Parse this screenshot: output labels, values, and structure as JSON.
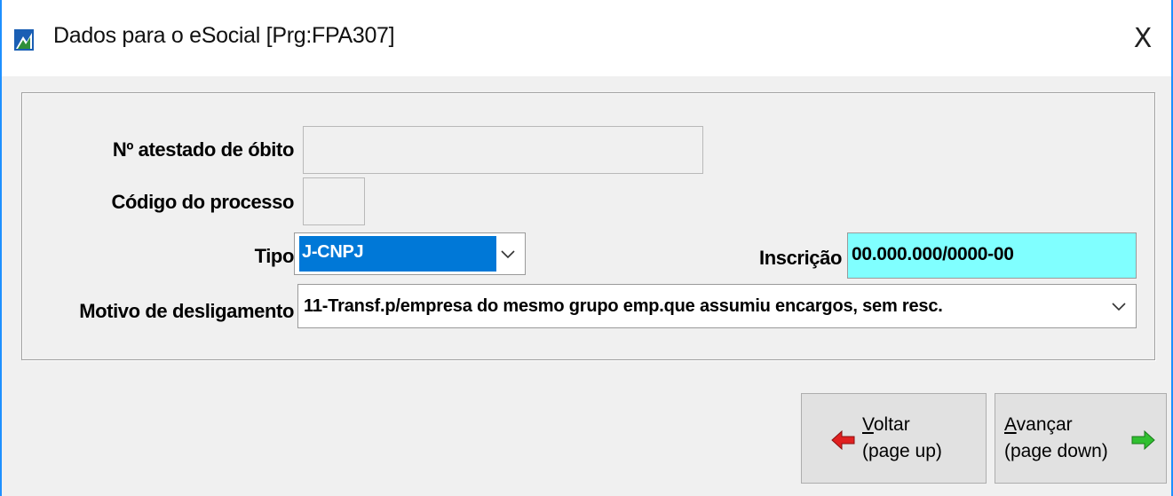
{
  "window": {
    "title": "Dados para o eSocial [Prg:FPA307]",
    "close_glyph": "X",
    "icon": "app-logo-icon"
  },
  "form": {
    "atestado_label": "Nº atestado de óbito",
    "atestado_value": "",
    "codigo_label": "Código do processo",
    "codigo_value": "",
    "tipo_label": "Tipo",
    "tipo_value": "J-CNPJ",
    "inscricao_label": "Inscrição",
    "inscricao_value": "00.000.000/0000-00",
    "motivo_label": "Motivo de desligamento",
    "motivo_value": "11-Transf.p/empresa do mesmo grupo emp.que assumiu encargos, sem resc."
  },
  "buttons": {
    "voltar_first": "V",
    "voltar_rest": "oltar",
    "voltar_hint": "(page up)",
    "avancar_first": "A",
    "avancar_rest": "vançar",
    "avancar_hint": "(page down)"
  },
  "colors": {
    "title_border": "#1e90ff",
    "selected_bg": "#0078d7",
    "inscricao_bg": "#80ffff",
    "back_arrow": "#e02020",
    "next_arrow": "#30c030"
  }
}
